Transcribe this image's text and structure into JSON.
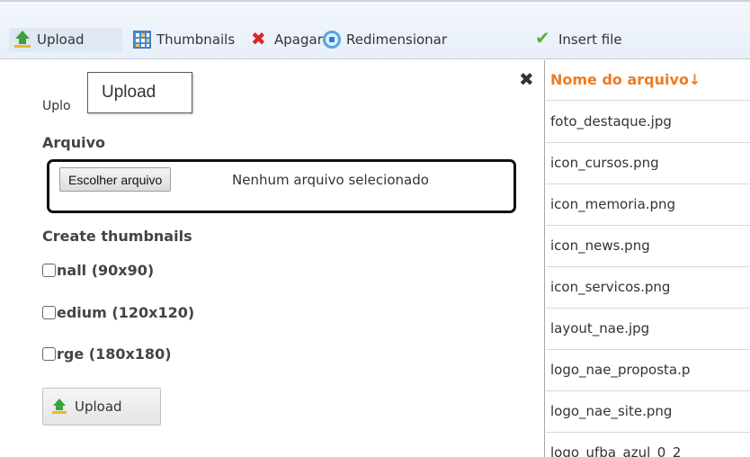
{
  "toolbar": {
    "upload_label": "Upload",
    "thumbnails_label": "Thumbnails",
    "delete_label": "Apagar",
    "resize_label": "Redimensionar",
    "insert_label": "Insert file"
  },
  "upload_panel": {
    "title_partial": "Uplo",
    "tooltip": "Upload",
    "close_symbol": "✖",
    "file_label": "Arquivo",
    "choose_file_button": "Escolher arquivo",
    "no_file_selected": "Nenhum arquivo selecionado",
    "thumbnails_heading": "Create thumbnails",
    "options": [
      {
        "label": "nall (90x90)",
        "checked": false
      },
      {
        "label": "edium (120x120)",
        "checked": false
      },
      {
        "label": "rge (180x180)",
        "checked": false
      }
    ],
    "submit_label": "Upload"
  },
  "file_list": {
    "header": "Nome do arquivo↓",
    "files": [
      "foto_destaque.jpg",
      "icon_cursos.png",
      "icon_memoria.png",
      "icon_news.png",
      "icon_servicos.png",
      "layout_nae.jpg",
      "logo_nae_proposta.p",
      "logo_nae_site.png",
      "logo_ufba_azul_0_2"
    ]
  },
  "colors": {
    "header_accent": "#f07a1e",
    "upload_green": "#3aa33a",
    "delete_red": "#d9262a",
    "insert_green": "#58b23b"
  }
}
